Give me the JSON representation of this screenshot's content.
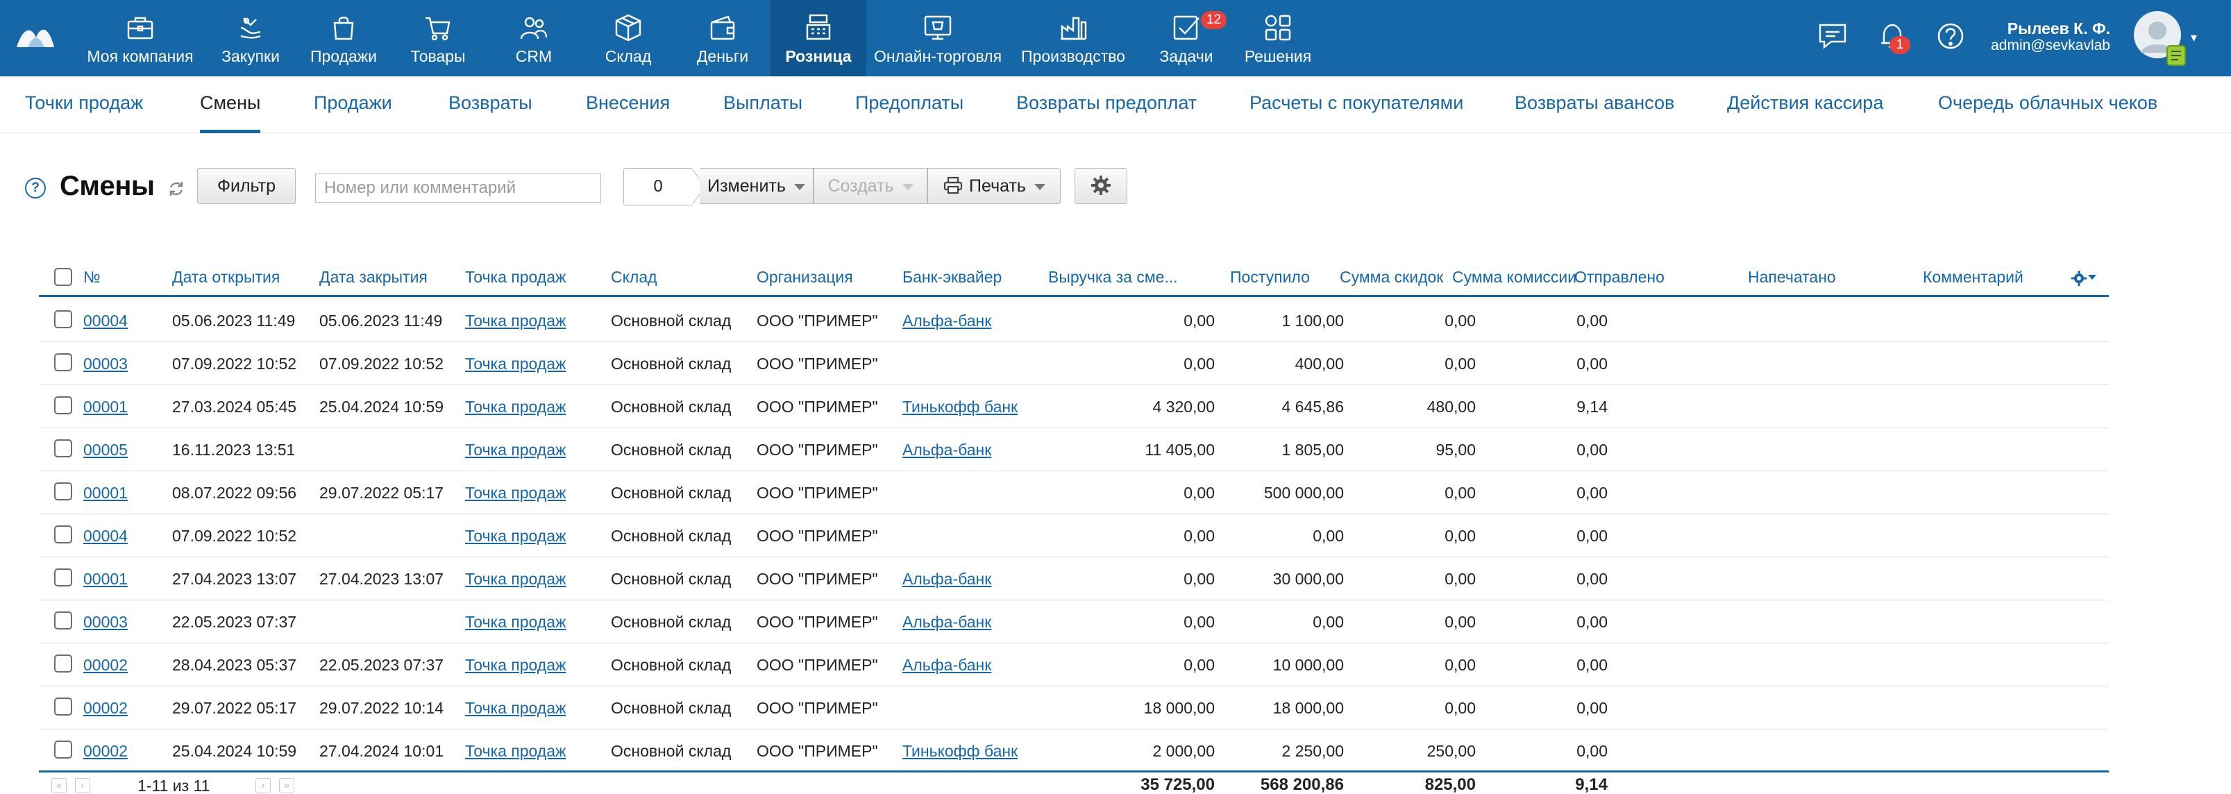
{
  "top_nav": {
    "items": [
      {
        "label": "Моя компания",
        "icon": "briefcase-icon"
      },
      {
        "label": "Закупки",
        "icon": "shopping-bag-hand-icon"
      },
      {
        "label": "Продажи",
        "icon": "bag-icon"
      },
      {
        "label": "Товары",
        "icon": "cart-icon"
      },
      {
        "label": "CRM",
        "icon": "users-icon"
      },
      {
        "label": "Склад",
        "icon": "box-icon"
      },
      {
        "label": "Деньги",
        "icon": "wallet-icon"
      },
      {
        "label": "Розница",
        "icon": "cash-register-icon",
        "active": true
      },
      {
        "label": "Онлайн-торговля",
        "icon": "online-store-icon"
      },
      {
        "label": "Производство",
        "icon": "factory-icon"
      },
      {
        "label": "Задачи",
        "icon": "tasks-check-icon",
        "badge": "12"
      },
      {
        "label": "Решения",
        "icon": "apps-grid-icon"
      }
    ],
    "notifications_badge": "1",
    "user": {
      "name": "Рылеев К. Ф.",
      "login": "admin@sevkavlab"
    },
    "colors": {
      "bar": "#1667a8",
      "active": "#0f5590",
      "badge": "#e8403a"
    }
  },
  "sub_nav": {
    "items": [
      {
        "label": "Точки продаж"
      },
      {
        "label": "Смены",
        "active": true
      },
      {
        "label": "Продажи"
      },
      {
        "label": "Возвраты"
      },
      {
        "label": "Внесения"
      },
      {
        "label": "Выплаты"
      },
      {
        "label": "Предоплаты"
      },
      {
        "label": "Возвраты предоплат"
      },
      {
        "label": "Расчеты с покупателями"
      },
      {
        "label": "Возвраты авансов"
      },
      {
        "label": "Действия кассира"
      },
      {
        "label": "Очередь облачных чеков"
      }
    ]
  },
  "toolbar": {
    "help": "?",
    "title": "Смены",
    "filter_label": "Фильтр",
    "search_placeholder": "Номер или комментарий",
    "selected_count": "0",
    "change_label": "Изменить",
    "create_label": "Создать",
    "print_label": "Печать"
  },
  "table": {
    "headers": {
      "num": "№",
      "opened": "Дата открытия",
      "closed": "Дата закрытия",
      "point": "Точка продаж",
      "warehouse": "Склад",
      "org": "Организация",
      "bank": "Банк-эквайер",
      "revenue": "Выручка за сме...",
      "received": "Поступило",
      "discount": "Сумма скидок",
      "commission": "Сумма комиссии",
      "sent": "Отправлено",
      "printed": "Напечатано",
      "comment": "Комментарий"
    },
    "rows": [
      {
        "num": "00004",
        "opened": "05.06.2023 11:49",
        "closed": "05.06.2023 11:49",
        "point": "Точка продаж",
        "warehouse": "Основной склад",
        "org": "ООО \"ПРИМЕР\"",
        "bank": "Альфа-банк",
        "revenue": "0,00",
        "received": "1 100,00",
        "discount": "0,00",
        "commission": "0,00"
      },
      {
        "num": "00003",
        "opened": "07.09.2022 10:52",
        "closed": "07.09.2022 10:52",
        "point": "Точка продаж",
        "warehouse": "Основной склад",
        "org": "ООО \"ПРИМЕР\"",
        "bank": "",
        "revenue": "0,00",
        "received": "400,00",
        "discount": "0,00",
        "commission": "0,00"
      },
      {
        "num": "00001",
        "opened": "27.03.2024 05:45",
        "closed": "25.04.2024 10:59",
        "point": "Точка продаж",
        "warehouse": "Основной склад",
        "org": "ООО \"ПРИМЕР\"",
        "bank": "Тинькофф банк",
        "revenue": "4 320,00",
        "received": "4 645,86",
        "discount": "480,00",
        "commission": "9,14"
      },
      {
        "num": "00005",
        "opened": "16.11.2023 13:51",
        "closed": "",
        "point": "Точка продаж",
        "warehouse": "Основной склад",
        "org": "ООО \"ПРИМЕР\"",
        "bank": "Альфа-банк",
        "revenue": "11 405,00",
        "received": "1 805,00",
        "discount": "95,00",
        "commission": "0,00"
      },
      {
        "num": "00001",
        "opened": "08.07.2022 09:56",
        "closed": "29.07.2022 05:17",
        "point": "Точка продаж",
        "warehouse": "Основной склад",
        "org": "ООО \"ПРИМЕР\"",
        "bank": "",
        "revenue": "0,00",
        "received": "500 000,00",
        "discount": "0,00",
        "commission": "0,00"
      },
      {
        "num": "00004",
        "opened": "07.09.2022 10:52",
        "closed": "",
        "point": "Точка продаж",
        "warehouse": "Основной склад",
        "org": "ООО \"ПРИМЕР\"",
        "bank": "",
        "revenue": "0,00",
        "received": "0,00",
        "discount": "0,00",
        "commission": "0,00"
      },
      {
        "num": "00001",
        "opened": "27.04.2023 13:07",
        "closed": "27.04.2023 13:07",
        "point": "Точка продаж",
        "warehouse": "Основной склад",
        "org": "ООО \"ПРИМЕР\"",
        "bank": "Альфа-банк",
        "revenue": "0,00",
        "received": "30 000,00",
        "discount": "0,00",
        "commission": "0,00"
      },
      {
        "num": "00003",
        "opened": "22.05.2023 07:37",
        "closed": "",
        "point": "Точка продаж",
        "warehouse": "Основной склад",
        "org": "ООО \"ПРИМЕР\"",
        "bank": "Альфа-банк",
        "revenue": "0,00",
        "received": "0,00",
        "discount": "0,00",
        "commission": "0,00"
      },
      {
        "num": "00002",
        "opened": "28.04.2023 05:37",
        "closed": "22.05.2023 07:37",
        "point": "Точка продаж",
        "warehouse": "Основной склад",
        "org": "ООО \"ПРИМЕР\"",
        "bank": "Альфа-банк",
        "revenue": "0,00",
        "received": "10 000,00",
        "discount": "0,00",
        "commission": "0,00"
      },
      {
        "num": "00002",
        "opened": "29.07.2022 05:17",
        "closed": "29.07.2022 10:14",
        "point": "Точка продаж",
        "warehouse": "Основной склад",
        "org": "ООО \"ПРИМЕР\"",
        "bank": "",
        "revenue": "18 000,00",
        "received": "18 000,00",
        "discount": "0,00",
        "commission": "0,00"
      },
      {
        "num": "00002",
        "opened": "25.04.2024 10:59",
        "closed": "27.04.2024 10:01",
        "point": "Точка продаж",
        "warehouse": "Основной склад",
        "org": "ООО \"ПРИМЕР\"",
        "bank": "Тинькофф банк",
        "revenue": "2 000,00",
        "received": "2 250,00",
        "discount": "250,00",
        "commission": "0,00"
      }
    ],
    "footer": {
      "pager_text": "1-11 из 11",
      "total_revenue": "35 725,00",
      "total_received": "568 200,86",
      "total_discount": "825,00",
      "total_commission": "9,14"
    }
  }
}
